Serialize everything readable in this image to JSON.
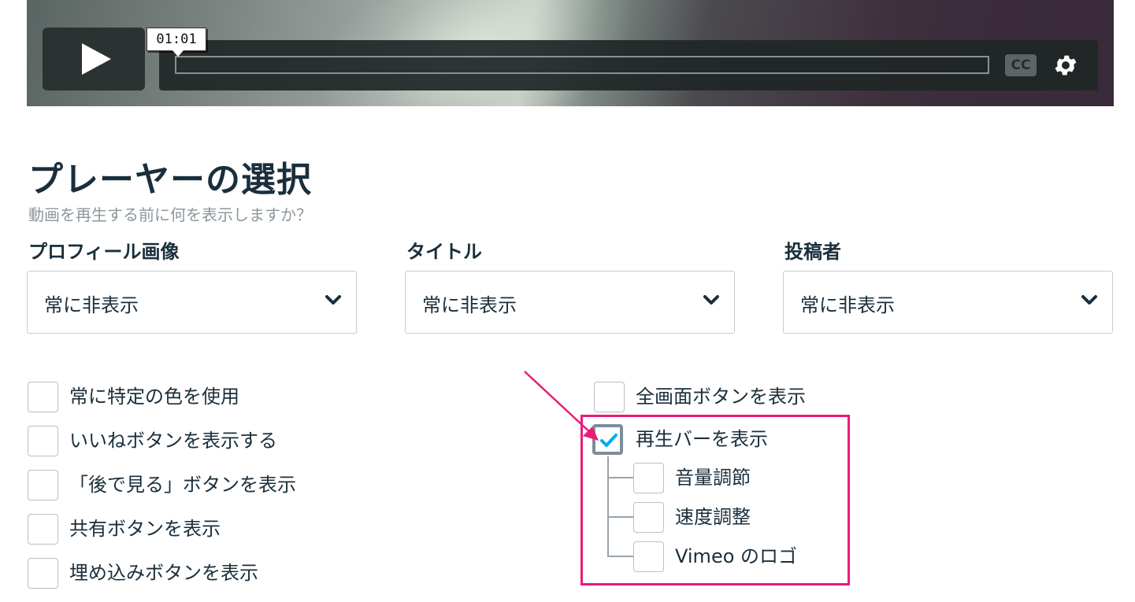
{
  "player": {
    "time_tooltip": "01:01",
    "cc_label": "CC",
    "play_icon": "play-icon",
    "settings_icon": "gear-icon",
    "progress": 0.0,
    "accent_color": "#00adef"
  },
  "header": {
    "title": "プレーヤーの選択",
    "subtitle": "動画を再生する前に何を表示しますか？"
  },
  "dropdowns": [
    {
      "label": "プロフィール画像",
      "value": "常に非表示"
    },
    {
      "label": "タイトル",
      "value": "常に非表示"
    },
    {
      "label": "投稿者",
      "value": "常に非表示"
    }
  ],
  "left_options": [
    {
      "label": "常に特定の色を使用",
      "checked": false
    },
    {
      "label": "いいねボタンを表示する",
      "checked": false
    },
    {
      "label": "「後で見る」ボタンを表示",
      "checked": false
    },
    {
      "label": "共有ボタンを表示",
      "checked": false
    },
    {
      "label": "埋め込みボタンを表示",
      "checked": false
    }
  ],
  "right_options": {
    "fullscreen": {
      "label": "全画面ボタンを表示",
      "checked": false
    },
    "playbar": {
      "label": "再生バーを表示",
      "checked": true
    },
    "sub_options": [
      {
        "label": "音量調節",
        "checked": false
      },
      {
        "label": "速度調整",
        "checked": false
      },
      {
        "label": "Vimeo のロゴ",
        "checked": false
      }
    ]
  },
  "annotation": {
    "highlight_color": "#ea1b7a"
  }
}
